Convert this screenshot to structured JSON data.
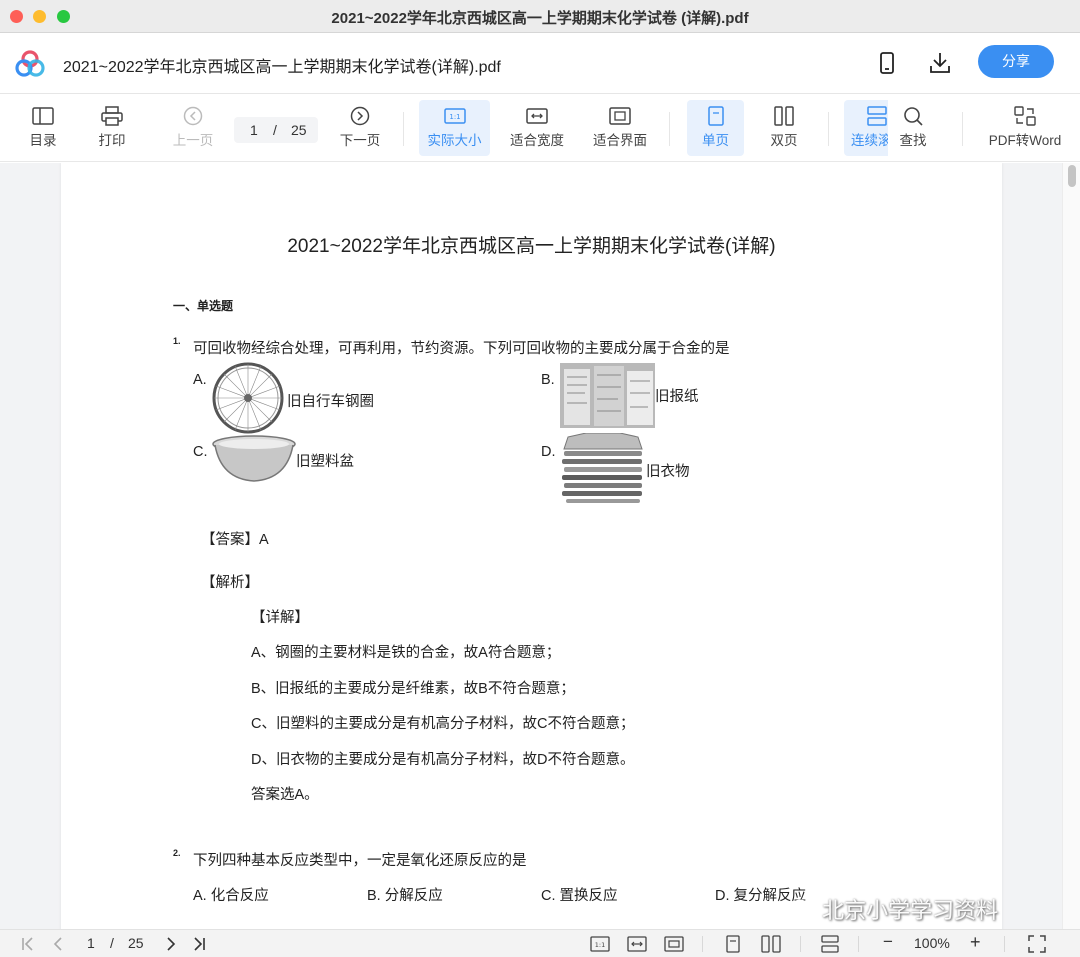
{
  "window": {
    "title": "2021~2022学年北京西城区高一上学期期末化学试卷 (详解).pdf"
  },
  "header": {
    "doc_title": "2021~2022学年北京西城区高一上学期期末化学试卷(详解).pdf",
    "share_label": "分享",
    "icons": [
      "app-logo",
      "phone-icon",
      "download-icon"
    ]
  },
  "toolbar": {
    "toc": "目录",
    "print": "打印",
    "prev": "上一页",
    "page_current": "1",
    "page_sep": "/",
    "page_total": "25",
    "next": "下一页",
    "actual_size": "实际大小",
    "fit_width": "适合宽度",
    "fit_screen": "适合界面",
    "single": "单页",
    "double": "双页",
    "continuous": "连续滚",
    "find": "查找",
    "pdf_word": "PDF转Word",
    "accent": "#3a8ff2"
  },
  "document": {
    "title": "2021~2022学年北京西城区高一上学期期末化学试卷(详解)",
    "section": "一、单选题",
    "q1": {
      "num": "1.",
      "text": "可回收物经综合处理，可再利用，节约资源。下列可回收物的主要成分属于合金的是",
      "options": [
        {
          "letter": "A.",
          "text": "旧自行车钢圈"
        },
        {
          "letter": "B.",
          "text": "旧报纸"
        },
        {
          "letter": "C.",
          "text": "旧塑料盆"
        },
        {
          "letter": "D.",
          "text": "旧衣物"
        }
      ],
      "answer": "【答案】A",
      "analysis": "【解析】",
      "detail": "【详解】",
      "lines": [
        "A、钢圈的主要材料是铁的合金，故A符合题意；",
        "B、旧报纸的主要成分是纤维素，故B不符合题意；",
        "C、旧塑料的主要成分是有机高分子材料，故C不符合题意；",
        "D、旧衣物的主要成分是有机高分子材料，故D不符合题意。",
        "答案选A。"
      ]
    },
    "q2": {
      "num": "2.",
      "text": "下列四种基本反应类型中，一定是氧化还原反应的是",
      "options": [
        "A. 化合反应",
        "B. 分解反应",
        "C. 置换反应",
        "D. 复分解反应"
      ]
    }
  },
  "bottom": {
    "page_current": "1",
    "page_sep": "/",
    "page_total": "25",
    "zoom": "100%",
    "minus": "−",
    "plus": "+"
  },
  "watermark": "北京小学学习资料"
}
